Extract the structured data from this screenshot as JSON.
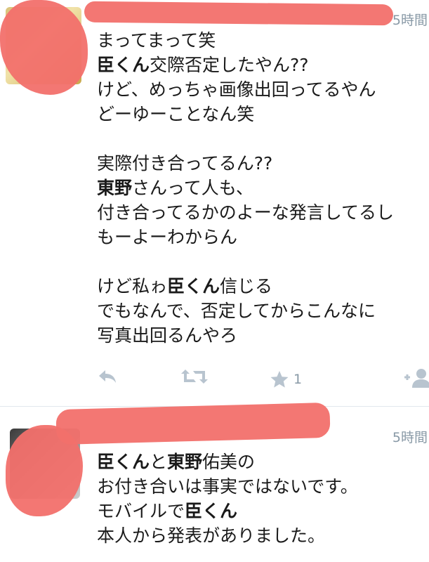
{
  "tweets": [
    {
      "timestamp": "5時間",
      "lines": [
        [
          {
            "t": "まってまって笑",
            "b": false
          }
        ],
        [
          {
            "t": "臣くん",
            "b": true
          },
          {
            "t": "交際否定したやん??",
            "b": false
          }
        ],
        [
          {
            "t": "けど、めっちゃ画像出回ってるやん",
            "b": false
          }
        ],
        [
          {
            "t": "どーゆーことなん笑",
            "b": false
          }
        ],
        [],
        [
          {
            "t": "実際付き合ってるん??",
            "b": false
          }
        ],
        [
          {
            "t": "東野",
            "b": true
          },
          {
            "t": "さんって人も、",
            "b": false
          }
        ],
        [
          {
            "t": "付き合ってるかのよーな発言してるし",
            "b": false
          }
        ],
        [
          {
            "t": "もーよーわからん",
            "b": false
          }
        ],
        [],
        [
          {
            "t": "けど私ゎ",
            "b": false
          },
          {
            "t": "臣くん",
            "b": true
          },
          {
            "t": "信じる",
            "b": false
          }
        ],
        [
          {
            "t": "でもなんで、否定してからこんなに",
            "b": false
          }
        ],
        [
          {
            "t": "写真出回るんやろ",
            "b": false
          }
        ]
      ],
      "actions": {
        "reply_icon": "reply-icon",
        "retweet_icon": "retweet-icon",
        "favorite_icon": "star-icon",
        "favorite_count": "1",
        "follow_icon": "add-user-icon"
      }
    },
    {
      "timestamp": "5時間",
      "lines": [
        [
          {
            "t": "臣くん",
            "b": true
          },
          {
            "t": "と",
            "b": false
          },
          {
            "t": "東野",
            "b": true
          },
          {
            "t": "佑美の",
            "b": false
          }
        ],
        [
          {
            "t": "お付き合いは事実ではないです。",
            "b": false
          }
        ],
        [
          {
            "t": "モバイルで",
            "b": false
          },
          {
            "t": "臣くん",
            "b": true
          }
        ],
        [
          {
            "t": "本人から発表がありました。",
            "b": false
          }
        ]
      ]
    }
  ],
  "colors": {
    "redaction": "#f2706c",
    "timestamp": "#8899a6",
    "action_icon": "#b8c4cf",
    "divider": "#e1e8ed"
  }
}
